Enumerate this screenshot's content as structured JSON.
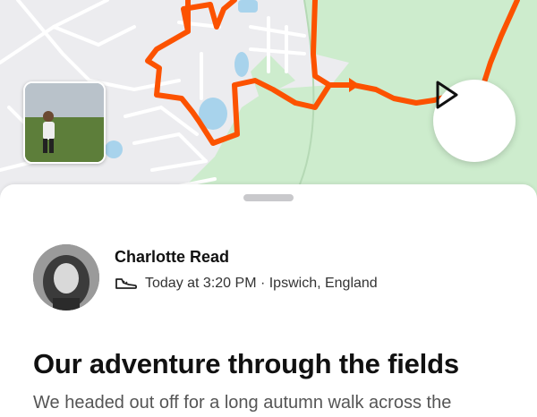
{
  "activity": {
    "athlete_name": "Charlotte Read",
    "timestamp": "Today at 3:20 PM",
    "separator": " · ",
    "location": "Ipswich, England",
    "title": "Our adventure through the fields",
    "description": "We headed out off for a long autumn walk across the"
  },
  "map": {
    "route_color": "#fc5200",
    "park_color": "#cdeccd",
    "water_color": "#a8d3ec",
    "road_color": "#ffffff"
  },
  "icons": {
    "play": "play-icon",
    "activity_type": "shoe-icon"
  }
}
